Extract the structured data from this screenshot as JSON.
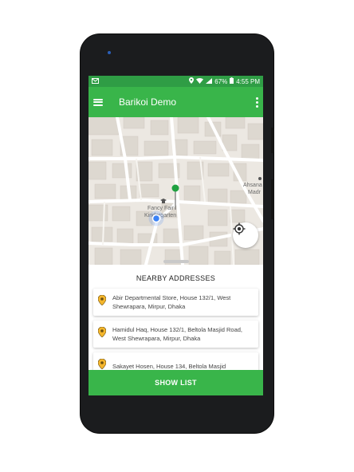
{
  "status": {
    "percent": "67%",
    "time": "4:55 PM"
  },
  "appbar": {
    "title": "Barikoi Demo"
  },
  "map": {
    "labels": {
      "place1": "Fancy Fair",
      "place2": "Kindergarten",
      "place3": "Ahsana",
      "place4": "Madr"
    }
  },
  "sheet": {
    "title": "NEARBY ADDRESSES",
    "items": [
      {
        "address": "Abir Departmental Store, House 132/1, West Shewrapara, Mirpur, Dhaka"
      },
      {
        "address": "Hamidul Haq, House 132/1, Beltola Masjid Road, West Shewrapara, Mirpur, Dhaka"
      },
      {
        "address": "Sakayet Hosen, House 134, Beltola Masjid"
      }
    ],
    "button": "SHOW LIST"
  },
  "colors": {
    "primary": "#39b54a",
    "statusbar": "#2f9d45",
    "marker": "#1fa140",
    "user_dot": "#3b82f6"
  }
}
